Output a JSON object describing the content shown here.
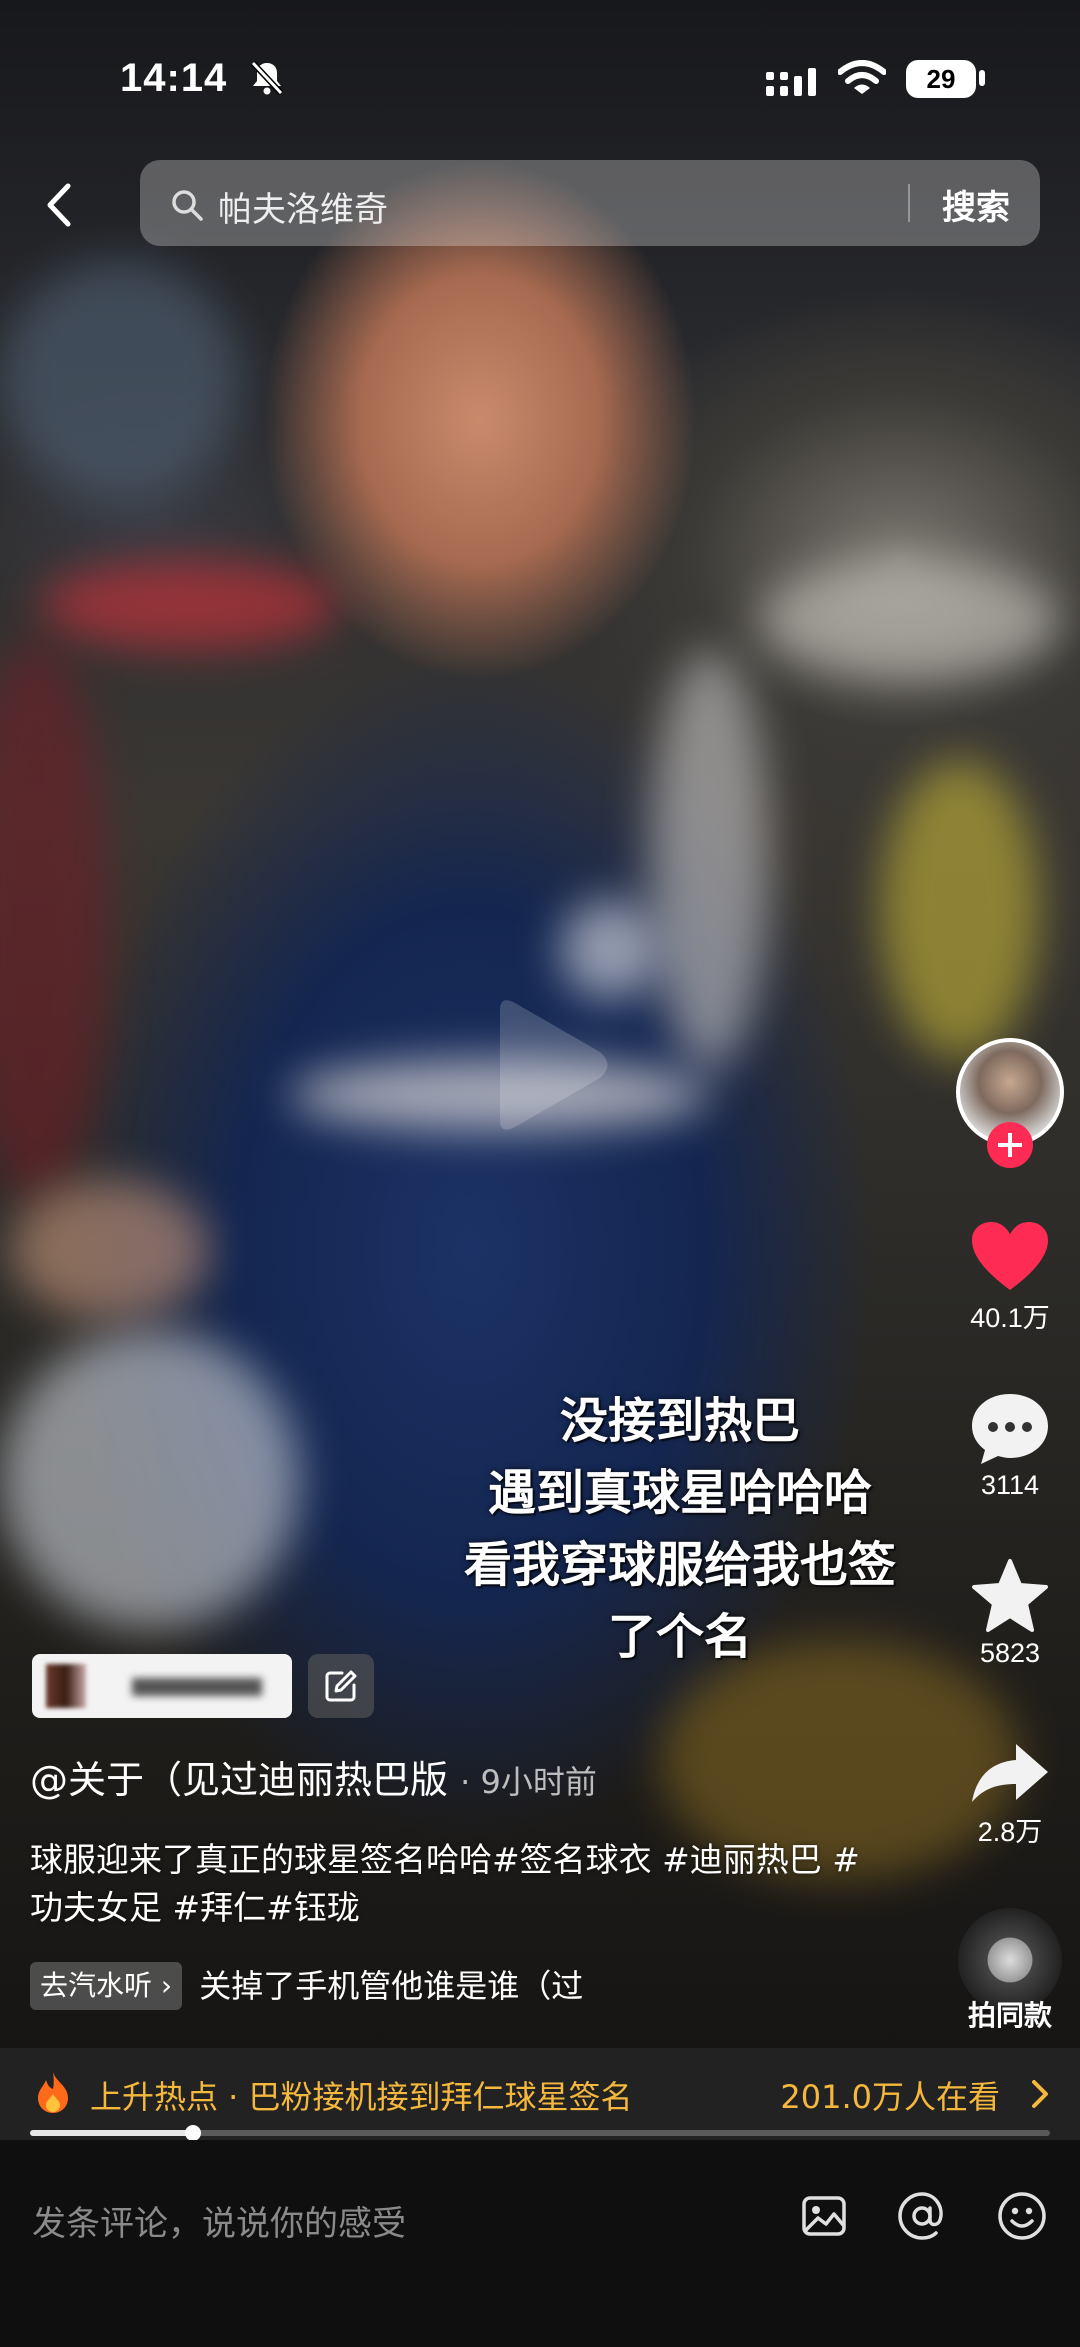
{
  "status_bar": {
    "time": "14:14",
    "battery": "29"
  },
  "search": {
    "query": "帕夫洛维奇",
    "button": "搜索"
  },
  "overlay_caption": [
    "没接到热巴",
    "遇到真球星哈哈哈",
    "看我穿球服给我也签",
    "了个名"
  ],
  "rail": {
    "likes": "40.1万",
    "comments": "3114",
    "favorites": "5823",
    "shares": "2.8万",
    "same_style": "拍同款"
  },
  "author": {
    "handle": "@关于（见过迪丽热巴版",
    "time_ago": "· 9小时前"
  },
  "description": "球服迎来了真正的球星签名哈哈#签名球衣 #迪丽热巴 #功夫女足 #拜仁#钰珑",
  "music": {
    "chip": "去汽水听",
    "title": "关掉了手机管他谁是谁（过"
  },
  "hot": {
    "label": "上升热点 · 巴粉接机接到拜仁球星签名",
    "viewers": "201.0万人在看"
  },
  "comment_input": {
    "placeholder": "发条评论，说说你的感受"
  },
  "colors": {
    "like": "#fe2c55",
    "hot": "#f5b83d",
    "plus": "#fe2c55"
  },
  "progress": 0.16
}
